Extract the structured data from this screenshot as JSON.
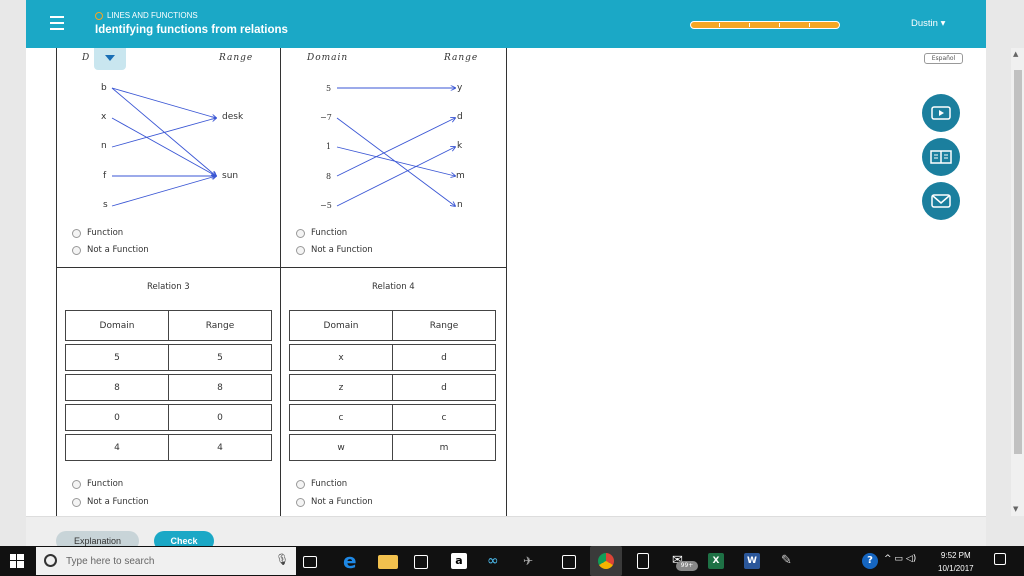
{
  "header": {
    "topic": "LINES AND FUNCTIONS",
    "title": "Identifying functions from relations",
    "user": "Dustin ▾",
    "espanol": "Español"
  },
  "mapping1": {
    "domain_header": "D",
    "range_header": "Range",
    "domain": [
      "b",
      "x",
      "n",
      "f",
      "s"
    ],
    "range": [
      "desk",
      "sun"
    ]
  },
  "mapping2": {
    "domain_header": "Domain",
    "range_header": "Range",
    "domain": [
      "5",
      "−7",
      "1",
      "8",
      "−5"
    ],
    "range": [
      "y",
      "d",
      "k",
      "m",
      "n"
    ]
  },
  "options": {
    "function": "Function",
    "not_function": "Not a Function"
  },
  "relation3": {
    "title": "Relation 3",
    "headers": [
      "Domain",
      "Range"
    ],
    "rows": [
      [
        "5",
        "5"
      ],
      [
        "8",
        "8"
      ],
      [
        "0",
        "0"
      ],
      [
        "4",
        "4"
      ]
    ]
  },
  "relation4": {
    "title": "Relation 4",
    "headers": [
      "Domain",
      "Range"
    ],
    "rows": [
      [
        "x",
        "d"
      ],
      [
        "z",
        "d"
      ],
      [
        "c",
        "c"
      ],
      [
        "w",
        "m"
      ]
    ]
  },
  "footer": {
    "explanation": "Explanation",
    "check": "Check"
  },
  "taskbar": {
    "search_placeholder": "Type here to search",
    "time": "9:52 PM",
    "date": "10/1/2017",
    "badge": "99+"
  }
}
